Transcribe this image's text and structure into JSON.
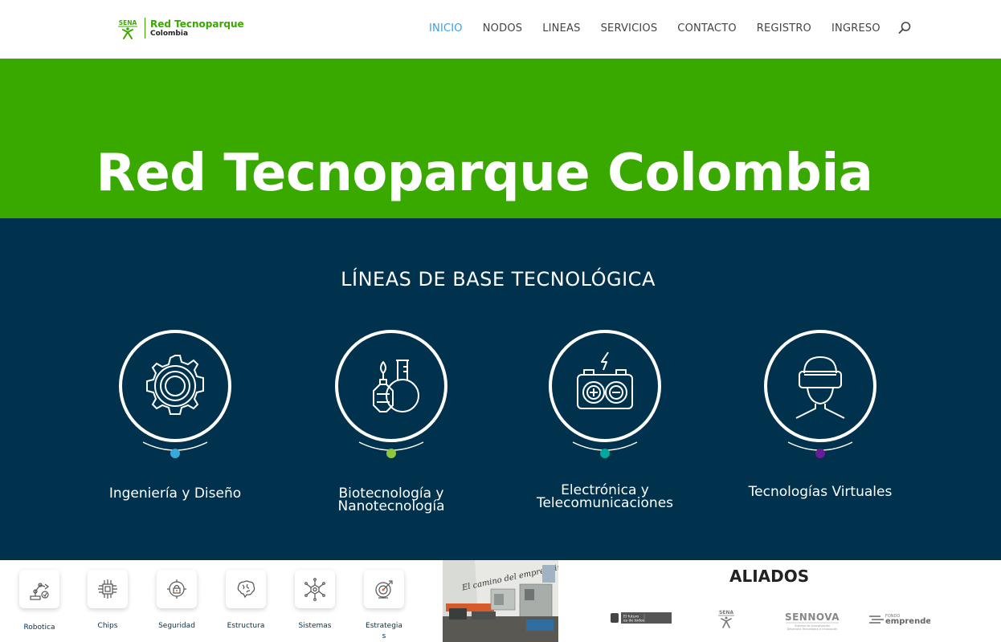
{
  "header": {
    "logo": {
      "mark": "SENA",
      "title": "Red Tecnoparque",
      "subtitle": "Colombia"
    },
    "nav": [
      {
        "label": "INICIO",
        "active": true
      },
      {
        "label": "NODOS",
        "active": false
      },
      {
        "label": "LINEAS",
        "active": false
      },
      {
        "label": "SERVICIOS",
        "active": false
      },
      {
        "label": "CONTACTO",
        "active": false
      },
      {
        "label": "REGISTRO",
        "active": false
      },
      {
        "label": "INGRESO",
        "active": false
      }
    ],
    "search_icon": "search-icon"
  },
  "hero": {
    "title": "Red Tecnoparque Colombia",
    "color": "#39a900"
  },
  "lines": {
    "heading": "LÍNEAS DE BASE TECNOLÓGICA",
    "background": "#00324d",
    "items": [
      {
        "label_1": "Ingeniería y Diseño",
        "label_2": "",
        "icon": "gear-icon",
        "dot_color": "#3aa8d8"
      },
      {
        "label_1": "Biotecnología y",
        "label_2": "Nanotecnología",
        "icon": "flask-icon",
        "dot_color": "#8dc63f"
      },
      {
        "label_1": "Electrónica y",
        "label_2": "Telecomunicaciones",
        "icon": "battery-icon",
        "dot_color": "#00a99d"
      },
      {
        "label_1": "Tecnologías Virtuales",
        "label_2": "",
        "icon": "vr-headset-icon",
        "dot_color": "#6a1b9a"
      }
    ]
  },
  "categories": [
    {
      "label_1": "Robotica",
      "label_2": "",
      "icon": "robot-arm-icon"
    },
    {
      "label_1": "Chips",
      "label_2": "",
      "icon": "chip-icon"
    },
    {
      "label_1": "Seguridad",
      "label_2": "",
      "icon": "security-icon"
    },
    {
      "label_1": "Estructura",
      "label_2": "",
      "icon": "brain-icon"
    },
    {
      "label_1": "Sistemas",
      "label_2": "",
      "icon": "network-icon"
    },
    {
      "label_1": "Estrategia",
      "label_2": "s",
      "icon": "target-icon"
    }
  ],
  "photo": {
    "caption": "El camino del emprendimiento"
  },
  "aliados": {
    "heading": "ALIADOS",
    "logos": [
      {
        "name": "Gobierno de Colombia",
        "text_1": "El futuro",
        "text_2": "es de todos"
      },
      {
        "name": "SENA",
        "text_1": "SENA"
      },
      {
        "name": "SENNOVA",
        "text_1": "SENNOVA",
        "text_2": "Sistema de Investigación",
        "text_3": "Desarrollo Tecnológico e Innovación"
      },
      {
        "name": "Fondo Emprender",
        "text_1": "FONDO",
        "text_2": "emprender"
      }
    ]
  }
}
